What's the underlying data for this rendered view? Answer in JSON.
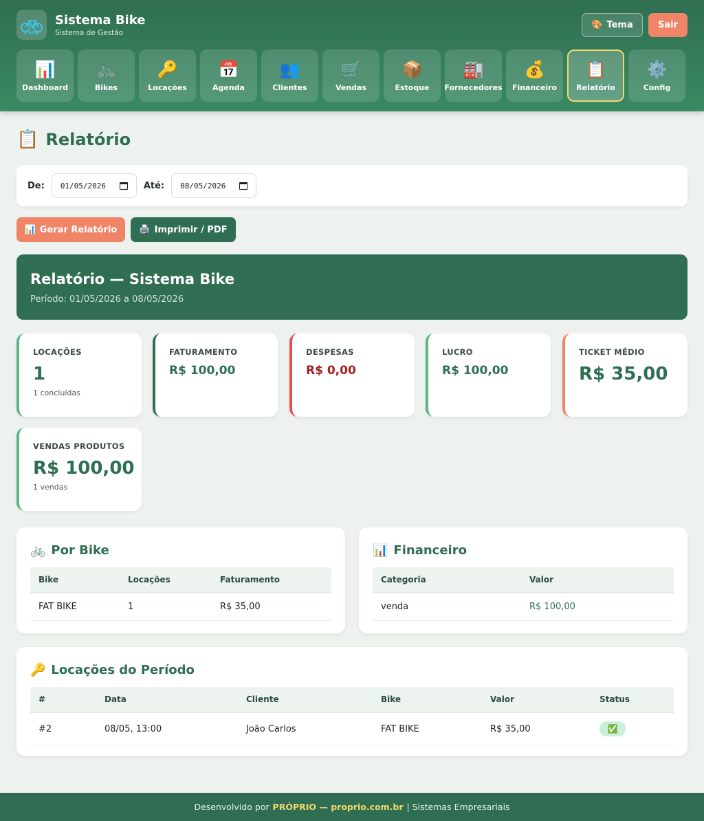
{
  "app": {
    "title": "Sistema Bike",
    "subtitle": "Sistema de Gestão",
    "logo_text": "E-BIKE"
  },
  "header_actions": {
    "theme_label": "Tema",
    "logout_label": "Sair"
  },
  "nav": [
    {
      "label": "Dashboard",
      "icon": "📊"
    },
    {
      "label": "Bikes",
      "icon": "🚲"
    },
    {
      "label": "Locações",
      "icon": "🔑"
    },
    {
      "label": "Agenda",
      "icon": "📅"
    },
    {
      "label": "Clientes",
      "icon": "👥"
    },
    {
      "label": "Vendas",
      "icon": "🛒"
    },
    {
      "label": "Estoque",
      "icon": "📦"
    },
    {
      "label": "Fornecedores",
      "icon": "🏭"
    },
    {
      "label": "Financeiro",
      "icon": "💰"
    },
    {
      "label": "Relatório",
      "icon": "📋"
    },
    {
      "label": "Config",
      "icon": "⚙️"
    }
  ],
  "page": {
    "title": "Relatório",
    "icon": "📋"
  },
  "filter": {
    "from_label": "De:",
    "from_value": "01/05/2026",
    "to_label": "Até:",
    "to_value": "08/05/2026"
  },
  "actions": {
    "generate_label": "Gerar Relatório",
    "print_label": "Imprimir / PDF"
  },
  "report": {
    "title": "Relatório — Sistema Bike",
    "period": "Período: 01/05/2026 a 08/05/2026"
  },
  "stats": {
    "locacoes": {
      "label": "LOCAÇÕES",
      "value": "1",
      "sub": "1 concluídas"
    },
    "faturamento": {
      "label": "FATURAMENTO",
      "value": "R$ 100,00"
    },
    "despesas": {
      "label": "DESPESAS",
      "value": "R$ 0,00"
    },
    "lucro": {
      "label": "LUCRO",
      "value": "R$ 100,00"
    },
    "ticket": {
      "label": "TICKET MÉDIO",
      "value": "R$ 35,00"
    },
    "vendas": {
      "label": "VENDAS PRODUTOS",
      "value": "R$ 100,00",
      "sub": "1 vendas"
    }
  },
  "por_bike": {
    "title": "Por Bike",
    "headers": [
      "Bike",
      "Locações",
      "Faturamento"
    ],
    "rows": [
      [
        "FAT BIKE",
        "1",
        "R$ 35,00"
      ]
    ]
  },
  "financeiro": {
    "title": "Financeiro",
    "headers": [
      "Categoria",
      "Valor"
    ],
    "rows": [
      [
        "venda",
        "R$ 100,00"
      ]
    ]
  },
  "locacoes_periodo": {
    "title": "Locações do Período",
    "headers": [
      "#",
      "Data",
      "Cliente",
      "Bike",
      "Valor",
      "Status"
    ],
    "rows": [
      [
        "#2",
        "08/05, 13:00",
        "João Carlos",
        "FAT BIKE",
        "R$ 35,00",
        "✅"
      ]
    ]
  },
  "footer": {
    "prefix": "Desenvolvido por",
    "brand": "PRÓPRIO — proprio.com.br",
    "suffix": "| Sistemas Empresariais"
  }
}
